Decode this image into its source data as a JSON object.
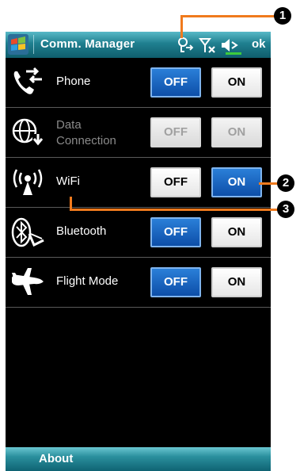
{
  "app": {
    "title": "Comm. Manager",
    "ok_label": "ok"
  },
  "status_icons": [
    "connectivity-icon",
    "signal-off-icon",
    "speaker-icon"
  ],
  "devices": [
    {
      "label": "Phone",
      "icon": "phone-icon",
      "off": "OFF",
      "on": "ON",
      "state": "off"
    },
    {
      "label": "Data Connection",
      "icon": "data-connection-icon",
      "off": "OFF",
      "on": "ON",
      "state": "disabled"
    },
    {
      "label": "WiFi",
      "icon": "wifi-icon",
      "off": "OFF",
      "on": "ON",
      "state": "on"
    },
    {
      "label": "Bluetooth",
      "icon": "bluetooth-icon",
      "off": "OFF",
      "on": "ON",
      "state": "off"
    },
    {
      "label": "Flight Mode",
      "icon": "airplane-icon",
      "off": "OFF",
      "on": "ON",
      "state": "off"
    }
  ],
  "softkey": {
    "label": "About"
  },
  "callouts": [
    "1",
    "2",
    "3"
  ],
  "colors": {
    "titlebar": "#1f7f8f",
    "accent_blue": "#0d4ea8",
    "callout_line": "#f07a1d"
  }
}
